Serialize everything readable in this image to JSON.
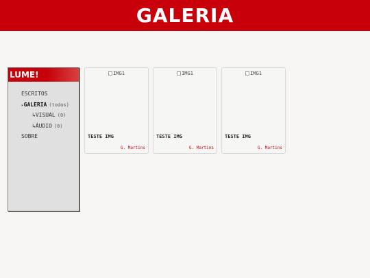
{
  "header": {
    "title": "GALERIA"
  },
  "sidebar": {
    "brand": "LUME!",
    "items": [
      {
        "label": "ESCRITOS",
        "marker": "",
        "count": ""
      },
      {
        "label": "GALERIA",
        "marker": "▸",
        "count": "(todos)"
      },
      {
        "label": "VISUAL",
        "marker": "↳",
        "count": "(0)"
      },
      {
        "label": "ÁUDIO",
        "marker": "↳",
        "count": "(0)"
      },
      {
        "label": "SOBRE",
        "marker": "",
        "count": ""
      }
    ]
  },
  "gallery": {
    "cards": [
      {
        "img_alt": "IMG1",
        "title": "TESTE IMG",
        "author": "G. Martins"
      },
      {
        "img_alt": "IMG1",
        "title": "TESTE IMG",
        "author": "G. Martins"
      },
      {
        "img_alt": "IMG1",
        "title": "TESTE IMG",
        "author": "G. Martins"
      }
    ]
  },
  "colors": {
    "accent": "#c8000a",
    "background": "#f7f5f3",
    "sidebar": "#e0e0e0"
  }
}
